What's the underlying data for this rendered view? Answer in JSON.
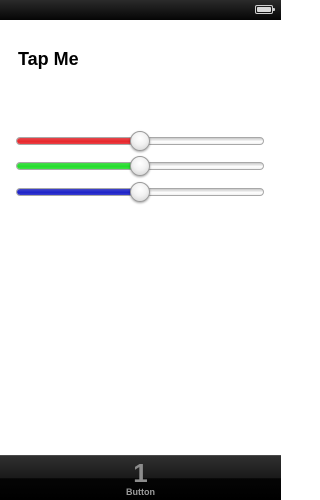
{
  "status_bar": {
    "battery_icon": "battery-full-icon",
    "battery_level": 1.0
  },
  "title": {
    "text": "Tap Me"
  },
  "sliders": [
    {
      "name": "red",
      "value": 0.5,
      "color": "#e8262b"
    },
    {
      "name": "green",
      "value": 0.5,
      "color": "#22dd2a"
    },
    {
      "name": "blue",
      "value": 0.5,
      "color": "#1d22c8"
    }
  ],
  "tab_bar": {
    "items": [
      {
        "glyph": "1",
        "label": "Button"
      }
    ]
  }
}
